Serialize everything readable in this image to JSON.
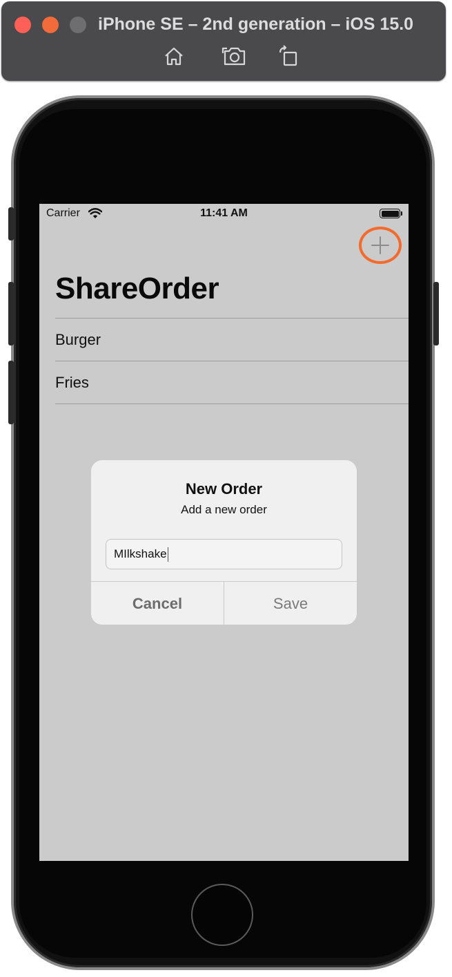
{
  "window": {
    "title": "iPhone SE – 2nd generation – iOS 15.0",
    "toolbar": {
      "home_icon": "home-icon",
      "screenshot_icon": "camera-icon",
      "rotate_icon": "rotate-icon"
    },
    "colors": {
      "close": "#fe5f57",
      "minimize": "#f26b3a",
      "zoom": "#6e6e70"
    }
  },
  "status_bar": {
    "carrier": "Carrier",
    "time": "11:41 AM"
  },
  "nav": {
    "title": "ShareOrder",
    "add_icon": "plus-icon",
    "highlight_color": "#f26a2c"
  },
  "list": {
    "items": [
      "Burger",
      "Fries"
    ]
  },
  "alert": {
    "title": "New Order",
    "message": "Add a new order",
    "field_value": "MIlkshake",
    "cancel_label": "Cancel",
    "save_label": "Save"
  }
}
